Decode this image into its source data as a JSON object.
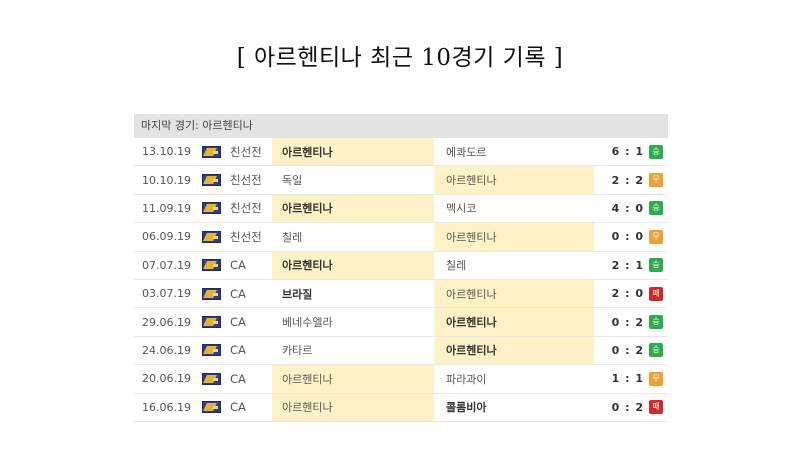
{
  "title": "[ 아르헨티나 최근 10경기 기록 ]",
  "table": {
    "header": "마지막 경기: 아르헨티나",
    "result_colors": {
      "승": "#2faa4e",
      "무": "#eda135",
      "패": "#d02a28"
    },
    "rows": [
      {
        "date": "13.10.19",
        "comp": "친선전",
        "home": "아르헨티나",
        "away": "에콰도르",
        "score": "6 : 1",
        "result": "승",
        "highlight": "home",
        "bold": "home"
      },
      {
        "date": "10.10.19",
        "comp": "친선전",
        "home": "독일",
        "away": "아르헨티나",
        "score": "2 : 2",
        "result": "무",
        "highlight": "away",
        "bold": ""
      },
      {
        "date": "11.09.19",
        "comp": "친선전",
        "home": "아르헨티나",
        "away": "멕시코",
        "score": "4 : 0",
        "result": "승",
        "highlight": "home",
        "bold": "home"
      },
      {
        "date": "06.09.19",
        "comp": "친선전",
        "home": "칠레",
        "away": "아르헨티나",
        "score": "0 : 0",
        "result": "무",
        "highlight": "away",
        "bold": ""
      },
      {
        "date": "07.07.19",
        "comp": "CA",
        "home": "아르헨티나",
        "away": "칠레",
        "score": "2 : 1",
        "result": "승",
        "highlight": "home",
        "bold": "home"
      },
      {
        "date": "03.07.19",
        "comp": "CA",
        "home": "브라질",
        "away": "아르헨티나",
        "score": "2 : 0",
        "result": "패",
        "highlight": "away",
        "bold": "home"
      },
      {
        "date": "29.06.19",
        "comp": "CA",
        "home": "베네수엘라",
        "away": "아르헨티나",
        "score": "0 : 2",
        "result": "승",
        "highlight": "away",
        "bold": "away"
      },
      {
        "date": "24.06.19",
        "comp": "CA",
        "home": "카타르",
        "away": "아르헨티나",
        "score": "0 : 2",
        "result": "승",
        "highlight": "away",
        "bold": "away"
      },
      {
        "date": "20.06.19",
        "comp": "CA",
        "home": "아르헨티나",
        "away": "파라과이",
        "score": "1 : 1",
        "result": "무",
        "highlight": "home",
        "bold": ""
      },
      {
        "date": "16.06.19",
        "comp": "CA",
        "home": "아르헨티나",
        "away": "콜롬비아",
        "score": "0 : 2",
        "result": "패",
        "highlight": "home",
        "bold": "away"
      }
    ]
  }
}
